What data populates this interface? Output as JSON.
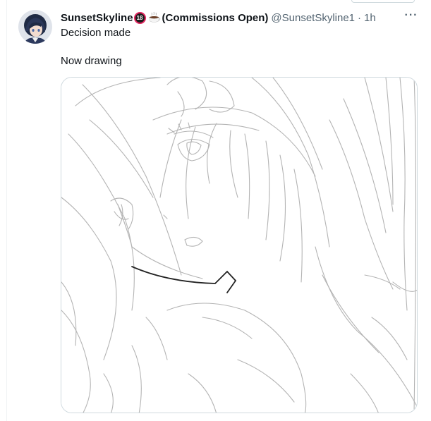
{
  "tweet": {
    "display_name": "SunsetSkyline",
    "badge_text": "18",
    "name_suffix": "(Commissions Open)",
    "handle": "@SunsetSkyline1",
    "separator": "·",
    "time": "1h",
    "more_glyph": "···",
    "text_line1": "Decision made",
    "text_line2": "Now drawing"
  },
  "icons": {
    "avatar": "avatar",
    "age_badge": "18-badge-icon",
    "cup": "coffee-cup-icon",
    "more": "more-icon"
  },
  "colors": {
    "text": "#0f1419",
    "secondary": "#536471",
    "border": "#cfd9de",
    "badge_ring": "#e0245e"
  }
}
